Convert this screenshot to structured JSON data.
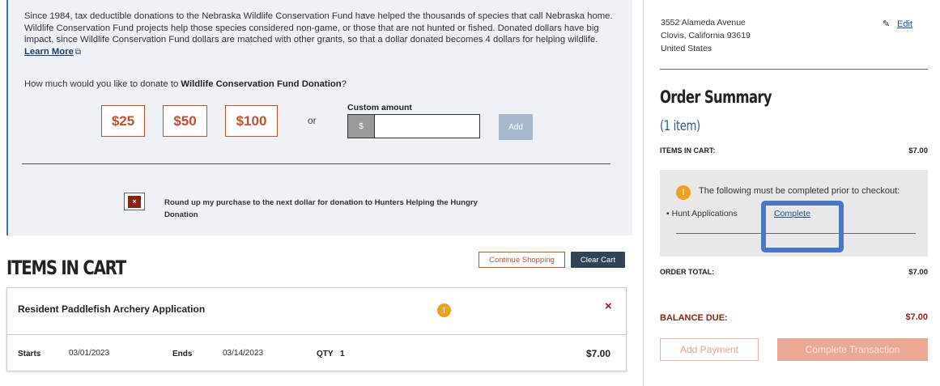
{
  "donation": {
    "description": "Since 1984, tax deductible donations to the Nebraska Wildlife Conservation Fund have helped the thousands of species that call Nebraska home. Wildlife Conservation Fund projects help those species considered non-game, or those that are not hunted or fished. Donated dollars have big impact, since Wildlife Conservation Fund dollars are matched with other grants, so that a dollar donated becomes 4 dollars for helping wildlife.",
    "learn_more": "Learn More",
    "question_prefix": "How much would you like to donate to ",
    "fund_name": "Wildlife Conservation Fund Donation",
    "question_suffix": "?",
    "amounts": [
      "$25",
      "$50",
      "$100"
    ],
    "or": "or",
    "custom_label": "Custom amount",
    "currency_prefix": "$",
    "custom_value": "",
    "add_label": "Add",
    "roundup_checked_mark": "×",
    "roundup_label": "Round up my purchase to the next dollar for donation to Hunters Helping the Hungry Donation"
  },
  "cart": {
    "title": "ITEMS IN CART",
    "continue_label": "Continue Shopping",
    "clear_label": "Clear Cart",
    "item": {
      "name": "Resident Paddlefish Archery Application",
      "warning_mark": "!",
      "remove_mark": "×",
      "starts_label": "Starts",
      "starts_value": "03/01/2023",
      "ends_label": "Ends",
      "ends_value": "03/14/2023",
      "qty_label": "QTY",
      "qty_value": "1",
      "price": "$7.00"
    }
  },
  "address": {
    "line1": "3552 Alameda Avenue",
    "line2": "Clovis, California  93619",
    "line3": "United States",
    "edit_label": "Edit"
  },
  "summary": {
    "title": "Order Summary",
    "count": "(1 item)",
    "items_label": "ITEMS IN CART:",
    "items_value": "$7.00",
    "warning_mark": "!",
    "warning_text": "The following must be completed prior to checkout:",
    "requirement_bullet": "•",
    "requirement": "Hunt Applications",
    "complete_link": "Complete",
    "total_label": "ORDER TOTAL:",
    "total_value": "$7.00",
    "balance_label": "BALANCE DUE:",
    "balance_value": "$7.00",
    "add_payment": "Add Payment",
    "complete_transaction": "Complete Transaction"
  },
  "colors": {
    "accent": "#c0502e",
    "dark_button": "#2f4456",
    "link": "#1a4f8a",
    "highlight": "#4a76c4",
    "warning": "#f0a020"
  },
  "icons": {
    "external_link": "external-link-icon",
    "edit": "pencil-icon",
    "warning": "warning-icon",
    "remove": "close-icon"
  }
}
